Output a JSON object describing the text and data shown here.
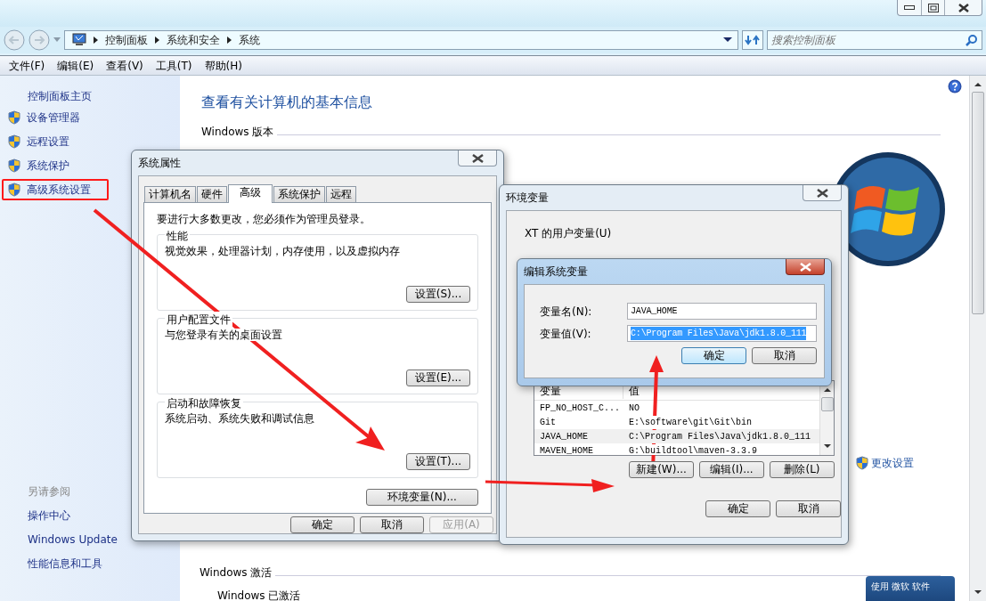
{
  "address_bar": {
    "breadcrumbs": [
      "控制面板",
      "系统和安全",
      "系统"
    ]
  },
  "search": {
    "placeholder": "搜索控制面板"
  },
  "menu": [
    "文件(F)",
    "编辑(E)",
    "查看(V)",
    "工具(T)",
    "帮助(H)"
  ],
  "sidebar": {
    "home": "控制面板主页",
    "items": [
      {
        "label": "设备管理器",
        "highlighted": false
      },
      {
        "label": "远程设置",
        "highlighted": false
      },
      {
        "label": "系统保护",
        "highlighted": false
      },
      {
        "label": "高级系统设置",
        "highlighted": true
      }
    ],
    "see_also_title": "另请参阅",
    "see_also": [
      "操作中心",
      "Windows Update",
      "性能信息和工具"
    ]
  },
  "main": {
    "heading": "查看有关计算机的基本信息",
    "edition_title": "Windows 版本",
    "change_settings": "更改设置",
    "activation_title": "Windows 激活",
    "activation_status": "Windows 已激活",
    "badge": "使用 微软 软件"
  },
  "system_properties": {
    "title": "系统属性",
    "tabs": [
      {
        "label": "计算机名",
        "selected": false
      },
      {
        "label": "硬件",
        "selected": false
      },
      {
        "label": "高级",
        "selected": true
      },
      {
        "label": "系统保护",
        "selected": false
      },
      {
        "label": "远程",
        "selected": false
      }
    ],
    "note": "要进行大多数更改，您必须作为管理员登录。",
    "groups": [
      {
        "title": "性能",
        "text": "视觉效果，处理器计划，内存使用，以及虚拟内存",
        "button": "设置(S)..."
      },
      {
        "title": "用户配置文件",
        "text": "与您登录有关的桌面设置",
        "button": "设置(E)..."
      },
      {
        "title": "启动和故障恢复",
        "text": "系统启动、系统失败和调试信息",
        "button": "设置(T)..."
      }
    ],
    "env_button": "环境变量(N)...",
    "buttons": [
      {
        "label": "确定",
        "disabled": false
      },
      {
        "label": "取消",
        "disabled": false
      },
      {
        "label": "应用(A)",
        "disabled": true
      }
    ]
  },
  "environment_variables": {
    "title": "环境变量",
    "user_group": "XT 的用户变量(U)",
    "system_table": {
      "columns": [
        "变量",
        "值"
      ],
      "rows": [
        {
          "name": "FP_NO_HOST_C...",
          "value": "NO",
          "selected": false
        },
        {
          "name": "Git",
          "value": "E:\\software\\git\\Git\\bin",
          "selected": false
        },
        {
          "name": "JAVA_HOME",
          "value": "C:\\Program Files\\Java\\jdk1.8.0_111",
          "selected": true
        },
        {
          "name": "MAVEN_HOME",
          "value": "G:\\buildtool\\maven-3.3.9",
          "selected": false
        }
      ]
    },
    "row_buttons": [
      "新建(W)...",
      "编辑(I)...",
      "删除(L)"
    ],
    "buttons": [
      "确定",
      "取消"
    ]
  },
  "edit_dialog": {
    "title": "编辑系统变量",
    "fields": [
      {
        "label": "变量名(N):",
        "value": "JAVA_HOME",
        "selected": false
      },
      {
        "label": "变量值(V):",
        "value": "C:\\Program Files\\Java\\jdk1.8.0_111",
        "selected": true
      }
    ],
    "buttons": [
      {
        "label": "确定",
        "default": true
      },
      {
        "label": "取消",
        "default": false
      }
    ]
  }
}
